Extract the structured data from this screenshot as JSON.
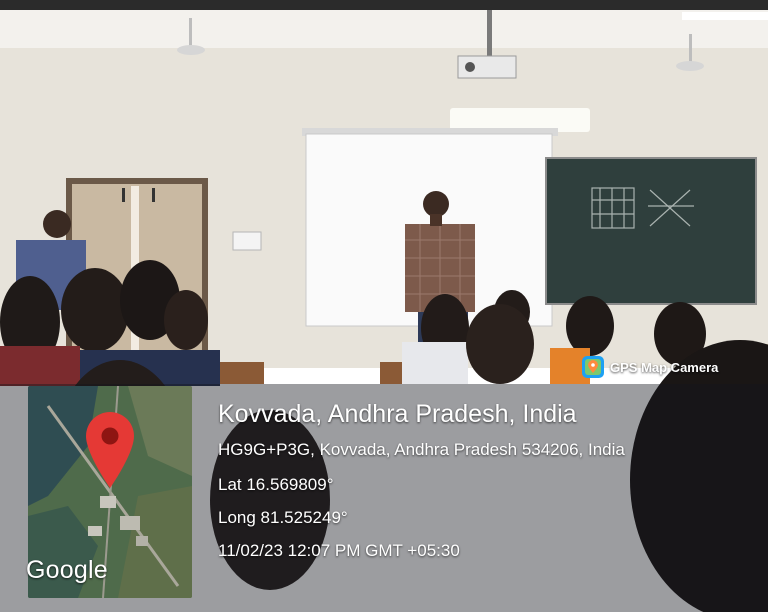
{
  "overlay": {
    "app_badge": "GPS Map Camera",
    "location_title": "Kovvada, Andhra Pradesh, India",
    "address": "HG9G+P3G, Kovvada, Andhra Pradesh 534206, India",
    "latitude": "Lat 16.569809°",
    "longitude": "Long 81.525249°",
    "timestamp": "11/02/23 12:07 PM GMT +05:30",
    "map_provider": "Google"
  },
  "icons": {
    "badge": "gps-map-camera-icon",
    "map_pin": "map-pin-icon"
  },
  "colors": {
    "pin": "#e53935",
    "badge_icon": "#1da1f2"
  }
}
